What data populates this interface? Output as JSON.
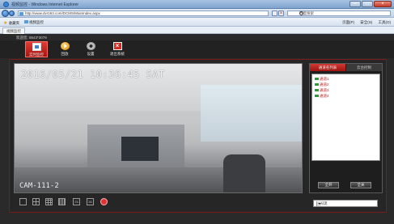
{
  "browser": {
    "title": "视频监控 - Windows Internet Explorer",
    "url": "http://www.dvr163.com/DCMS/MainIndex.aspx",
    "search_placeholder": "百度搜索",
    "favorites_label": "收藏夹",
    "site_label": "视频监控",
    "tab_label": "视频监控",
    "commands": [
      "页面(P)",
      "安全(S)",
      "工具(O)"
    ]
  },
  "app": {
    "welcome": "欢迎您: 8643*3079",
    "toolbar": [
      {
        "label": "实时监控",
        "icon": "monitor-icon",
        "active": true
      },
      {
        "label": "回放",
        "icon": "play-icon",
        "active": false
      },
      {
        "label": "设置",
        "icon": "gear-icon",
        "active": false
      },
      {
        "label": "退出系统",
        "icon": "exit-icon",
        "active": false
      }
    ],
    "video": {
      "osd_time": "2016/05/21 10:36:45 SAT",
      "osd_camera": "CAM-111-2"
    },
    "layouts": [
      "1",
      "4",
      "9",
      "16",
      "25",
      "36"
    ],
    "panel": {
      "tabs": [
        "通道名列表",
        "云台控制"
      ],
      "channels": [
        "通道1",
        "通道2",
        "通道3",
        "通道4"
      ],
      "open_all": "全开",
      "close_all": "全关"
    },
    "stream_select": {
      "value": "子码流"
    }
  }
}
